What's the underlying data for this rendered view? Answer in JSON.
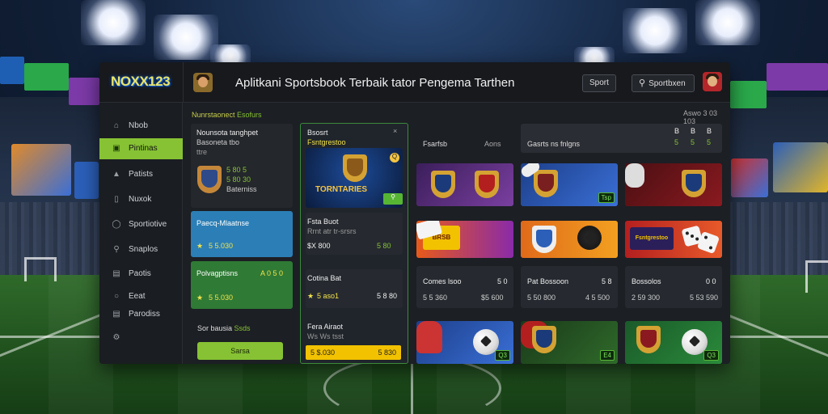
{
  "app": {
    "logo": "NOXX123",
    "title": "Aplitkani Sportsbook Terbaik tator Pengema Tarthen",
    "search_button": "Sport",
    "search_label": "Sportbxen"
  },
  "sidebar": {
    "items": [
      {
        "label": "Nbob",
        "icon": "home-icon"
      },
      {
        "label": "Pintinas",
        "icon": "promo-icon",
        "active": true
      },
      {
        "label": "Patists",
        "icon": "trophy-icon"
      },
      {
        "label": "Nuxok",
        "icon": "bookmark-icon"
      },
      {
        "label": "Sportiotive",
        "icon": "sports-icon"
      },
      {
        "label": "Snaplos",
        "icon": "search-icon"
      },
      {
        "label": "Paotis",
        "icon": "chart-icon"
      },
      {
        "label": "Eeat",
        "icon": "circle-icon"
      },
      {
        "label": "Parodiss",
        "icon": "list-icon"
      },
      {
        "label": "",
        "icon": "settings-icon"
      }
    ]
  },
  "header_strip": {
    "left": "Nunrstaonect",
    "left_accent": "Esofurs",
    "right": "Aswo 3 03 103"
  },
  "col1": {
    "featured": {
      "title": "Nounsota tanghpet",
      "subtitle": "Basoneta tbo",
      "meta": "ttre",
      "stat1": "5 80 5",
      "stat2": "5 80 30",
      "stat3": "Baterniss"
    },
    "blue_card": {
      "title": "Paecq-Mlaatnse",
      "value": "5 5.030"
    },
    "green_card": {
      "title": "Polvagptisns",
      "value": "5 5.030",
      "odds": "A 0 5 0"
    },
    "footer_label": "Sor bausia",
    "footer_accent": "Ssds",
    "cta": "Sarsa"
  },
  "col2": {
    "header_title": "Bsosrt",
    "header_sub": "Fsntgrestoo",
    "banner_text": "TORNTARIES",
    "banner_tag": "Q",
    "match1": {
      "title": "Fsta Buot",
      "sub": "Rrnt atr tr-srsrs",
      "odds_left": "$X 800",
      "odds_right": "5 80"
    },
    "match2": {
      "title": "Cotina Bat",
      "odds_left": "5 aso1",
      "odds_right": "5 8 80"
    },
    "match3": {
      "title": "Fera Airaot",
      "sub": "Ws Ws tsst",
      "odds_left": "5 $.030",
      "odds_right": "5 830"
    }
  },
  "col3": {
    "tabs": [
      "Fsarfsb",
      "Aons"
    ],
    "panel_title": "Gasrts ns fnlgns",
    "scores": [
      "B",
      "B",
      "B",
      "5",
      "5",
      "5"
    ],
    "tile_text_1": "BRSB",
    "tile_text_2": "Fsntgrestoo",
    "row1": [
      {
        "title": "Comes lsoo",
        "stat": "5 0",
        "left": "5 5 360",
        "right": "$5 600"
      },
      {
        "title": "Pat Bossoon",
        "stat": "5 8",
        "left": "5 50 800",
        "right": "4 5 500"
      },
      {
        "title": "Bossolos",
        "stat": "0 0",
        "left": "2 59 300",
        "right": "5 53 590"
      }
    ],
    "badges": [
      "Tsp",
      "Q3",
      "E4",
      "E3",
      "Q3"
    ]
  },
  "colors": {
    "accent": "#86c233",
    "blue": "#2b7fb6",
    "green": "#2f7a35",
    "yellow": "#f2c200"
  }
}
